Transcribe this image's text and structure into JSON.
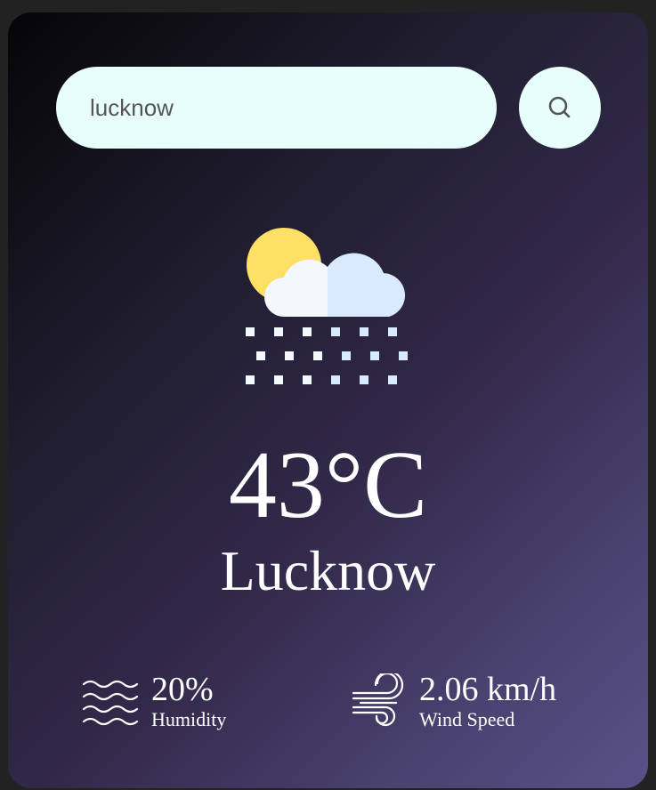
{
  "search": {
    "value": "lucknow",
    "icon": "search-icon"
  },
  "weather": {
    "icon": "snow-cloud-sun-icon",
    "temperature": "43°C",
    "city": "Lucknow"
  },
  "humidity": {
    "icon": "humidity-waves-icon",
    "value": "20%",
    "label": "Humidity"
  },
  "wind": {
    "icon": "wind-icon",
    "value": "2.06 km/h",
    "label": "Wind Speed"
  },
  "colors": {
    "search_bg": "#e8fefb",
    "sun": "#ffe066",
    "cloud_light": "#f3f8fc",
    "cloud_dark": "#d8eafc",
    "text": "#ffffff"
  }
}
